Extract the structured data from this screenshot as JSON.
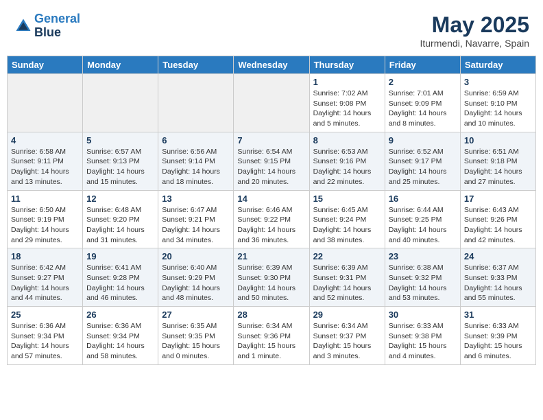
{
  "header": {
    "logo_line1": "General",
    "logo_line2": "Blue",
    "month": "May 2025",
    "location": "Iturmendi, Navarre, Spain"
  },
  "weekdays": [
    "Sunday",
    "Monday",
    "Tuesday",
    "Wednesday",
    "Thursday",
    "Friday",
    "Saturday"
  ],
  "weeks": [
    [
      {
        "day": "",
        "info": ""
      },
      {
        "day": "",
        "info": ""
      },
      {
        "day": "",
        "info": ""
      },
      {
        "day": "",
        "info": ""
      },
      {
        "day": "1",
        "info": "Sunrise: 7:02 AM\nSunset: 9:08 PM\nDaylight: 14 hours\nand 5 minutes."
      },
      {
        "day": "2",
        "info": "Sunrise: 7:01 AM\nSunset: 9:09 PM\nDaylight: 14 hours\nand 8 minutes."
      },
      {
        "day": "3",
        "info": "Sunrise: 6:59 AM\nSunset: 9:10 PM\nDaylight: 14 hours\nand 10 minutes."
      }
    ],
    [
      {
        "day": "4",
        "info": "Sunrise: 6:58 AM\nSunset: 9:11 PM\nDaylight: 14 hours\nand 13 minutes."
      },
      {
        "day": "5",
        "info": "Sunrise: 6:57 AM\nSunset: 9:13 PM\nDaylight: 14 hours\nand 15 minutes."
      },
      {
        "day": "6",
        "info": "Sunrise: 6:56 AM\nSunset: 9:14 PM\nDaylight: 14 hours\nand 18 minutes."
      },
      {
        "day": "7",
        "info": "Sunrise: 6:54 AM\nSunset: 9:15 PM\nDaylight: 14 hours\nand 20 minutes."
      },
      {
        "day": "8",
        "info": "Sunrise: 6:53 AM\nSunset: 9:16 PM\nDaylight: 14 hours\nand 22 minutes."
      },
      {
        "day": "9",
        "info": "Sunrise: 6:52 AM\nSunset: 9:17 PM\nDaylight: 14 hours\nand 25 minutes."
      },
      {
        "day": "10",
        "info": "Sunrise: 6:51 AM\nSunset: 9:18 PM\nDaylight: 14 hours\nand 27 minutes."
      }
    ],
    [
      {
        "day": "11",
        "info": "Sunrise: 6:50 AM\nSunset: 9:19 PM\nDaylight: 14 hours\nand 29 minutes."
      },
      {
        "day": "12",
        "info": "Sunrise: 6:48 AM\nSunset: 9:20 PM\nDaylight: 14 hours\nand 31 minutes."
      },
      {
        "day": "13",
        "info": "Sunrise: 6:47 AM\nSunset: 9:21 PM\nDaylight: 14 hours\nand 34 minutes."
      },
      {
        "day": "14",
        "info": "Sunrise: 6:46 AM\nSunset: 9:22 PM\nDaylight: 14 hours\nand 36 minutes."
      },
      {
        "day": "15",
        "info": "Sunrise: 6:45 AM\nSunset: 9:24 PM\nDaylight: 14 hours\nand 38 minutes."
      },
      {
        "day": "16",
        "info": "Sunrise: 6:44 AM\nSunset: 9:25 PM\nDaylight: 14 hours\nand 40 minutes."
      },
      {
        "day": "17",
        "info": "Sunrise: 6:43 AM\nSunset: 9:26 PM\nDaylight: 14 hours\nand 42 minutes."
      }
    ],
    [
      {
        "day": "18",
        "info": "Sunrise: 6:42 AM\nSunset: 9:27 PM\nDaylight: 14 hours\nand 44 minutes."
      },
      {
        "day": "19",
        "info": "Sunrise: 6:41 AM\nSunset: 9:28 PM\nDaylight: 14 hours\nand 46 minutes."
      },
      {
        "day": "20",
        "info": "Sunrise: 6:40 AM\nSunset: 9:29 PM\nDaylight: 14 hours\nand 48 minutes."
      },
      {
        "day": "21",
        "info": "Sunrise: 6:39 AM\nSunset: 9:30 PM\nDaylight: 14 hours\nand 50 minutes."
      },
      {
        "day": "22",
        "info": "Sunrise: 6:39 AM\nSunset: 9:31 PM\nDaylight: 14 hours\nand 52 minutes."
      },
      {
        "day": "23",
        "info": "Sunrise: 6:38 AM\nSunset: 9:32 PM\nDaylight: 14 hours\nand 53 minutes."
      },
      {
        "day": "24",
        "info": "Sunrise: 6:37 AM\nSunset: 9:33 PM\nDaylight: 14 hours\nand 55 minutes."
      }
    ],
    [
      {
        "day": "25",
        "info": "Sunrise: 6:36 AM\nSunset: 9:34 PM\nDaylight: 14 hours\nand 57 minutes."
      },
      {
        "day": "26",
        "info": "Sunrise: 6:36 AM\nSunset: 9:34 PM\nDaylight: 14 hours\nand 58 minutes."
      },
      {
        "day": "27",
        "info": "Sunrise: 6:35 AM\nSunset: 9:35 PM\nDaylight: 15 hours\nand 0 minutes."
      },
      {
        "day": "28",
        "info": "Sunrise: 6:34 AM\nSunset: 9:36 PM\nDaylight: 15 hours\nand 1 minute."
      },
      {
        "day": "29",
        "info": "Sunrise: 6:34 AM\nSunset: 9:37 PM\nDaylight: 15 hours\nand 3 minutes."
      },
      {
        "day": "30",
        "info": "Sunrise: 6:33 AM\nSunset: 9:38 PM\nDaylight: 15 hours\nand 4 minutes."
      },
      {
        "day": "31",
        "info": "Sunrise: 6:33 AM\nSunset: 9:39 PM\nDaylight: 15 hours\nand 6 minutes."
      }
    ]
  ]
}
